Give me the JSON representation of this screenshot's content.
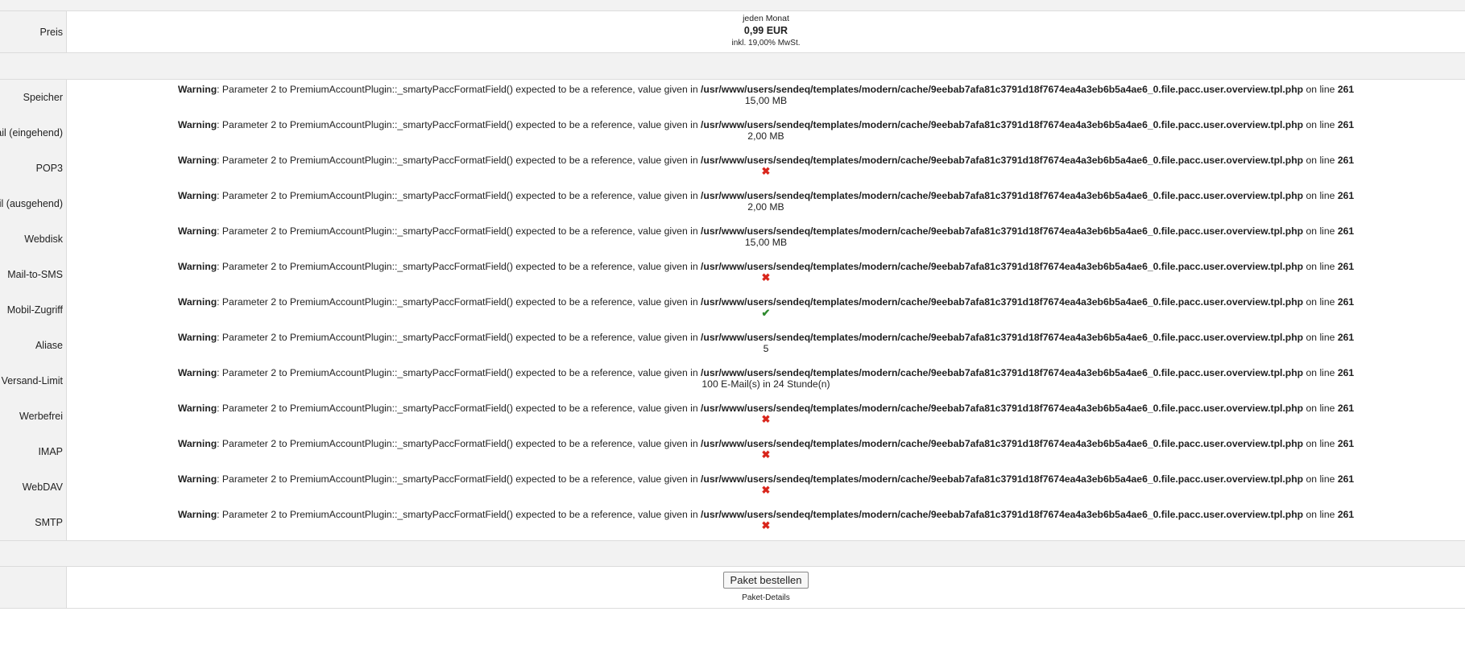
{
  "price": {
    "label": "Preis",
    "period": "jeden Monat",
    "amount": "0,99 EUR",
    "tax_note": "inkl. 19,00% MwSt."
  },
  "warning": {
    "prefix": "Warning",
    "message": ": Parameter 2 to PremiumAccountPlugin::_smartyPaccFormatField() expected to be a reference, value given in ",
    "path": "/usr/www/users/sendeq/templates/modern/cache/9eebab7afa81c3791d18f7674ea4a3eb6b5a4ae6_0.file.pacc.user.overview.tpl.php",
    "line_text": " on line ",
    "line_number": "261"
  },
  "features": [
    {
      "label": "Speicher",
      "value": "15,00 MB",
      "icon": ""
    },
    {
      "label": "ail (eingehend)",
      "value": "2,00 MB",
      "icon": ""
    },
    {
      "label": "POP3",
      "value": "✖",
      "icon": "cross-icon"
    },
    {
      "label": "ail (ausgehend)",
      "value": "2,00 MB",
      "icon": ""
    },
    {
      "label": "Webdisk",
      "value": "15,00 MB",
      "icon": ""
    },
    {
      "label": "Mail-to-SMS",
      "value": "✖",
      "icon": "cross-icon"
    },
    {
      "label": "Mobil-Zugriff",
      "value": "✔",
      "icon": "check-icon"
    },
    {
      "label": "Aliase",
      "value": "5",
      "icon": ""
    },
    {
      "label": "Versand-Limit",
      "value": "100 E-Mail(s) in 24 Stunde(n)",
      "icon": ""
    },
    {
      "label": "Werbefrei",
      "value": "✖",
      "icon": "cross-icon"
    },
    {
      "label": "IMAP",
      "value": "✖",
      "icon": "cross-icon"
    },
    {
      "label": "WebDAV",
      "value": "✖",
      "icon": "cross-icon"
    },
    {
      "label": "SMTP",
      "value": "✖",
      "icon": "cross-icon"
    }
  ],
  "order": {
    "button_label": "Paket bestellen",
    "details_link": "Paket-Details"
  },
  "colors": {
    "cross": "#d9261c",
    "check": "#2f8a2f",
    "label_background": "#f2f2f2"
  }
}
